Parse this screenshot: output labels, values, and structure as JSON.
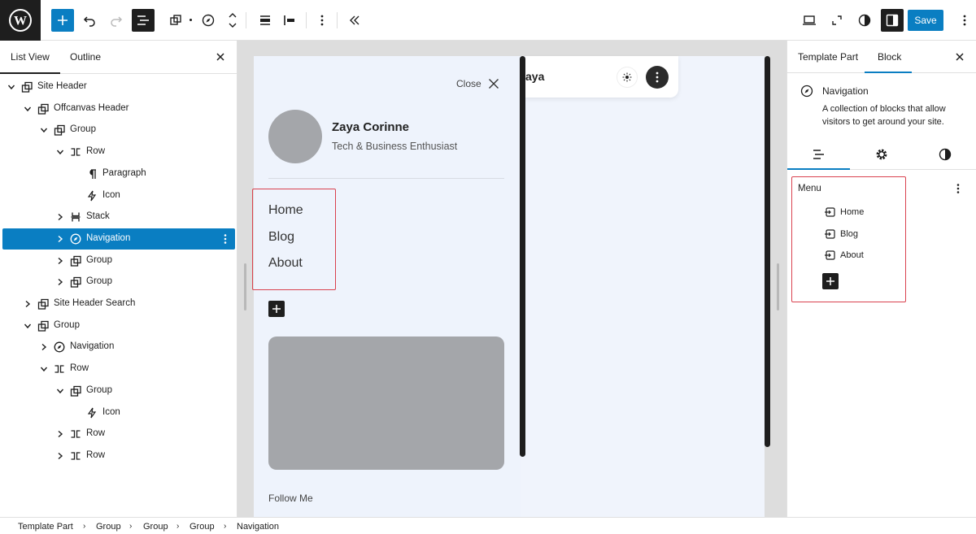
{
  "toolbar": {
    "save_label": "Save",
    "accent_color": "#0a7ec2"
  },
  "left_panel": {
    "tabs": [
      "List View",
      "Outline"
    ],
    "tree": [
      {
        "label": "Site Header",
        "icon": "template-part-icon",
        "depth": 0,
        "expanded": true
      },
      {
        "label": "Offcanvas Header",
        "icon": "template-part-icon",
        "depth": 1,
        "expanded": true
      },
      {
        "label": "Group",
        "icon": "group-icon",
        "depth": 2,
        "expanded": true
      },
      {
        "label": "Row",
        "icon": "row-icon",
        "depth": 3,
        "expanded": true
      },
      {
        "label": "Paragraph",
        "icon": "paragraph-icon",
        "depth": 4,
        "expanded": null
      },
      {
        "label": "Icon",
        "icon": "bolt-icon",
        "depth": 4,
        "expanded": null
      },
      {
        "label": "Stack",
        "icon": "stack-icon",
        "depth": 3,
        "expanded": false
      },
      {
        "label": "Navigation",
        "icon": "compass-icon",
        "depth": 3,
        "expanded": false,
        "selected": true
      },
      {
        "label": "Group",
        "icon": "group-icon",
        "depth": 3,
        "expanded": false
      },
      {
        "label": "Group",
        "icon": "group-icon",
        "depth": 3,
        "expanded": false
      },
      {
        "label": "Site Header Search",
        "icon": "template-part-icon",
        "depth": 1,
        "expanded": false
      },
      {
        "label": "Group",
        "icon": "group-icon",
        "depth": 1,
        "expanded": true
      },
      {
        "label": "Navigation",
        "icon": "compass-icon",
        "depth": 2,
        "expanded": false
      },
      {
        "label": "Row",
        "icon": "row-icon",
        "depth": 2,
        "expanded": true
      },
      {
        "label": "Group",
        "icon": "group-icon",
        "depth": 3,
        "expanded": true
      },
      {
        "label": "Icon",
        "icon": "bolt-icon",
        "depth": 4,
        "expanded": null
      },
      {
        "label": "Row",
        "icon": "row-icon",
        "depth": 3,
        "expanded": false
      },
      {
        "label": "Row",
        "icon": "row-icon",
        "depth": 3,
        "expanded": false
      }
    ]
  },
  "canvas": {
    "close_label": "Close",
    "profile_name": "Zaya Corinne",
    "profile_subtitle": "Tech & Business Enthusiast",
    "nav_items": [
      "Home",
      "Blog",
      "About"
    ],
    "follow_label": "Follow Me",
    "header_name": "aya"
  },
  "right_panel": {
    "tabs": [
      "Template Part",
      "Block"
    ],
    "block_title": "Navigation",
    "block_description": "A collection of blocks that allow visitors to get around your site.",
    "menu_title": "Menu",
    "menu_items": [
      "Home",
      "Blog",
      "About"
    ]
  },
  "breadcrumbs": [
    "Template Part",
    "Group",
    "Group",
    "Group",
    "Navigation"
  ]
}
